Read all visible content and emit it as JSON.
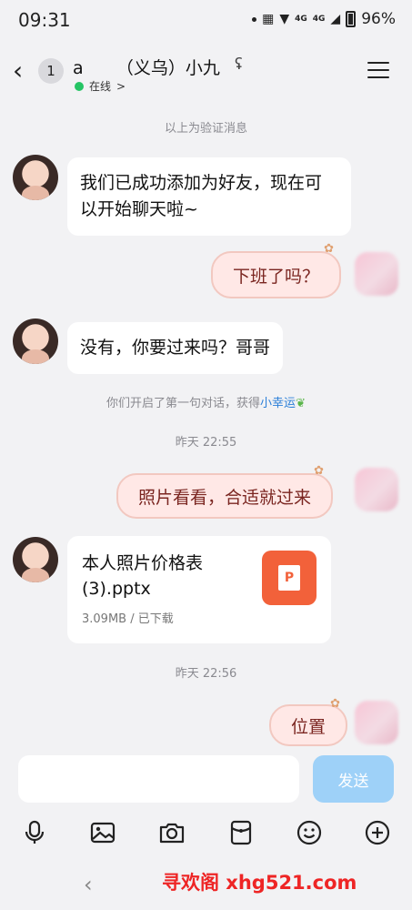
{
  "status_bar": {
    "time": "09:31",
    "network_a": "4G",
    "network_b": "4G",
    "battery": "96%"
  },
  "header": {
    "back_label": "‹",
    "unread_count": "1",
    "contact_name": "a      （义乌）小九",
    "online_status": "在线",
    "online_chevron": ">"
  },
  "messages": {
    "sys_verify": "以上为验证消息",
    "in_1": "我们已成功添加为好友，现在可以开始聊天啦~",
    "out_1": "下班了吗？",
    "in_2": "没有，你要过来吗？哥哥",
    "sys_lucky_prefix": "你们开启了第一句对话，获得",
    "sys_lucky_link": "小幸运",
    "time_1": "昨天 22:55",
    "out_2": "照片看看，合适就过来",
    "file": {
      "name": "本人照片价格表(3).pptx",
      "meta": "3.09MB / 已下载",
      "icon_letter": "P"
    },
    "time_2": "昨天 22:56",
    "out_3": "位置"
  },
  "input": {
    "send_label": "发送",
    "placeholder": ""
  },
  "bottom": {
    "watermark": "寻欢阁 xhg521.com"
  },
  "colors": {
    "online": "#25c464",
    "send": "#9ed1f8",
    "ppt": "#f2613a",
    "link": "#2b7fd8"
  }
}
